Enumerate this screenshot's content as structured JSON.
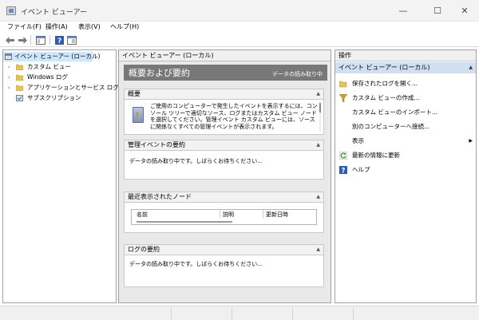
{
  "window": {
    "title": "イベント ビューアー",
    "minimize": "—",
    "maximize": "☐",
    "close": "✕"
  },
  "menu": [
    "ファイル(F)",
    "操作(A)",
    "表示(V)",
    "ヘルプ(H)"
  ],
  "toolbar": {
    "icons": [
      "back-arrow-icon",
      "forward-arrow-icon",
      "console-tree-icon",
      "help-icon",
      "properties-icon"
    ]
  },
  "tree": {
    "root": "イベント ビューアー (ローカル)",
    "items": [
      "カスタム ビュー",
      "Windows ログ",
      "アプリケーションとサービス ログ",
      "サブスクリプション"
    ]
  },
  "center": {
    "header": "イベント ビューアー (ローカル)",
    "overview_title": "概要および要約",
    "overview_status": "データの読み取り中",
    "sections": {
      "summary": {
        "title": "概要",
        "text": "ご使用のコンピューターで発生したイベントを表示するには、コンソール ツリーで適切なソース、ログまたはカスタム ビュー ノードを選択してください。管理イベント カスタム ビューには、ソースに関係なくすべての管理イベントが表示されます。"
      },
      "admin_events": {
        "title": "管理イベントの要約",
        "text": "データの読み取り中です。しばらくお待ちください..."
      },
      "recent_nodes": {
        "title": "最近表示されたノード",
        "columns": [
          "名前",
          "説明",
          "更新日時"
        ]
      },
      "log_summary": {
        "title": "ログの要約",
        "text": "データの読み取り中です。しばらくお待ちください..."
      }
    }
  },
  "actions": {
    "header": "操作",
    "subheader": "イベント ビューアー (ローカル)",
    "items": [
      {
        "label": "保存されたログを開く...",
        "icon": "folder-open-icon"
      },
      {
        "label": "カスタム ビューの作成...",
        "icon": "filter-icon"
      },
      {
        "label": "カスタム ビューのインポート...",
        "icon": ""
      },
      {
        "label": "別のコンピューターへ接続...",
        "icon": ""
      },
      {
        "label": "表示",
        "icon": ""
      },
      {
        "label": "最新の情報に更新",
        "icon": "refresh-icon"
      },
      {
        "label": "ヘルプ",
        "icon": "help-icon"
      }
    ]
  },
  "colors": {
    "selection": "#cce8ff",
    "banner": "#787878",
    "actions_subheader": "#cfe0f3"
  }
}
